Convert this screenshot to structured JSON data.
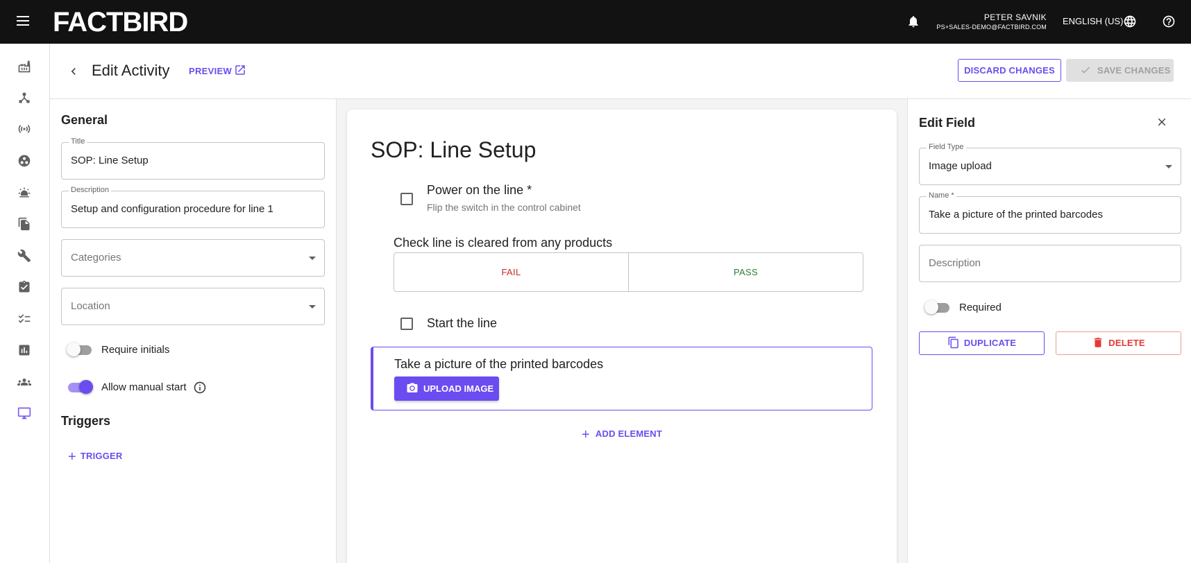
{
  "app": {
    "logo": "FACTBIRD"
  },
  "topbar": {
    "user_name": "PETER SAVNIK",
    "user_email": "PS+SALES-DEMO@FACTBIRD.COM",
    "language": "ENGLISH (US)"
  },
  "header": {
    "title": "Edit Activity",
    "preview_label": "PREVIEW",
    "discard_label": "DISCARD CHANGES",
    "save_label": "SAVE CHANGES"
  },
  "general": {
    "section_title": "General",
    "title_label": "Title",
    "title_value": "SOP: Line Setup",
    "description_label": "Description",
    "description_value": "Setup and configuration procedure for line 1",
    "categories_placeholder": "Categories",
    "location_placeholder": "Location",
    "require_initials_label": "Require initials",
    "require_initials_on": false,
    "allow_manual_start_label": "Allow manual start",
    "allow_manual_start_on": true
  },
  "triggers": {
    "section_title": "Triggers",
    "add_trigger_label": "TRIGGER"
  },
  "sop": {
    "title": "SOP: Line Setup",
    "items": [
      {
        "type": "checkbox",
        "title": "Power on the line *",
        "subtitle": "Flip the switch in the control cabinet"
      },
      {
        "type": "passfail",
        "title": "Check line is cleared from any products",
        "fail_label": "FAIL",
        "pass_label": "PASS"
      },
      {
        "type": "checkbox",
        "title": "Start the line"
      },
      {
        "type": "image",
        "title": "Take a picture of the printed barcodes",
        "button_label": "UPLOAD IMAGE"
      }
    ],
    "add_element_label": "ADD ELEMENT"
  },
  "edit_field": {
    "title": "Edit Field",
    "field_type_label": "Field Type",
    "field_type_value": "Image upload",
    "name_label": "Name *",
    "name_value": "Take a picture of the printed barcodes",
    "description_placeholder": "Description",
    "required_label": "Required",
    "required_on": false,
    "duplicate_label": "DUPLICATE",
    "delete_label": "DELETE"
  },
  "colors": {
    "accent": "#6b4cf0",
    "fail": "#c62828",
    "pass": "#2e7d32",
    "topbar": "#121212"
  }
}
